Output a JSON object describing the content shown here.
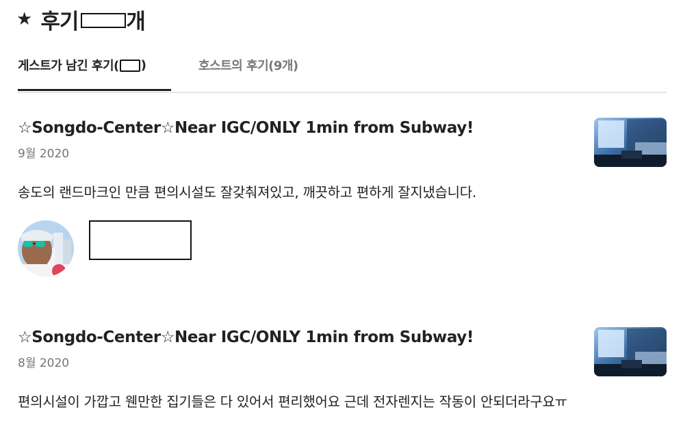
{
  "header": {
    "star_icon": "star-icon",
    "title": "후기 "
  },
  "tabs": [
    {
      "label_prefix": "게스트가 남긴 후기(",
      "label_suffix": ")",
      "active": true
    },
    {
      "label": "호스트의 후기(9개)",
      "active": false
    }
  ],
  "reviews": [
    {
      "listing_title": "☆Songdo-Center☆Near IGC/ONLY 1min from Subway!",
      "date": "9월 2020",
      "text": "송도의 랜드마크인 만큼 편의시설도 잘갖춰져있고, 깨끗하고 편하게 잘지냈습니다."
    },
    {
      "listing_title": "☆Songdo-Center☆Near IGC/ONLY 1min from Subway!",
      "date": "8월 2020",
      "text": "편의시설이 가깝고 웬만한 집기들은 다 있어서 편리했어요 근데 전자렌지는 작동이 안되더라구요ㅠ"
    }
  ],
  "colors": {
    "text_primary": "#222222",
    "text_secondary": "#757575",
    "divider": "#e4e4e4"
  }
}
